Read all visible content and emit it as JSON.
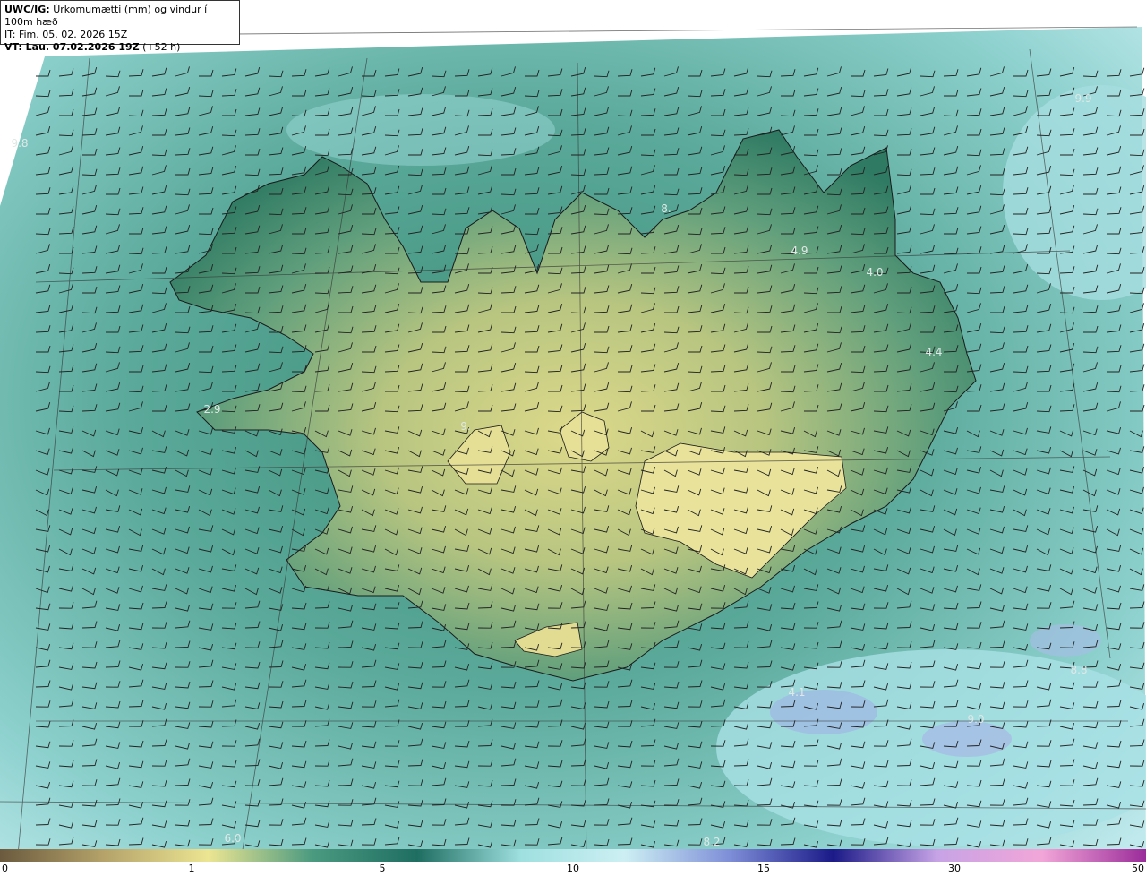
{
  "header": {
    "model": "UWC/IG:",
    "description": "Úrkomumætti (mm) og vindur í 100m hæð",
    "init_time": "IT: Fim. 05. 02. 2026 15Z",
    "valid_prefix": "VT: Lau. 07.02.2026 19Z",
    "valid_suffix": "(+52 h)"
  },
  "colorbar": {
    "ticks": [
      "0",
      "1",
      "5",
      "10",
      "15",
      "30",
      "50"
    ],
    "colors": [
      "#6b5a3e",
      "#b5a36a",
      "#ece592",
      "#4a9a80",
      "#1f6e62",
      "#9fe0e0",
      "#cdeff3",
      "#7f8fd8",
      "#1b1a88",
      "#c7a3e6",
      "#f2a6d8",
      "#9b2c9a"
    ]
  },
  "map": {
    "point_values": [
      "9.9",
      "9.8",
      "4.9",
      "4.0",
      "4.4",
      "2.9",
      "8.",
      "6.0",
      "9.",
      "9.0",
      "4.1",
      "8.8",
      "8.2"
    ]
  }
}
